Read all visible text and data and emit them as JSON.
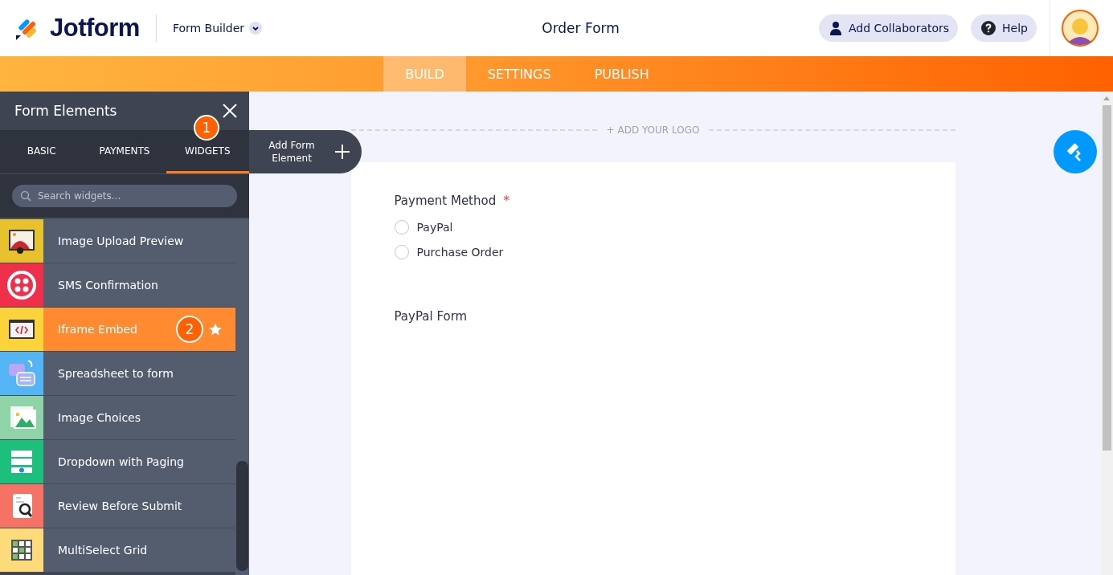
{
  "header": {
    "brand": "Jotform",
    "menu": "Form Builder",
    "title": "Order Form",
    "buttons": [
      "Add Collaborators",
      "Help"
    ]
  },
  "nav_tabs": [
    {
      "label": "BUILD",
      "selected": true
    },
    {
      "label": "SETTINGS",
      "selected": false
    },
    {
      "label": "PUBLISH",
      "selected": false
    }
  ],
  "sidebar": {
    "title": "Form Elements",
    "tabs": [
      {
        "label": "BASIC",
        "selected": false
      },
      {
        "label": "PAYMENTS",
        "selected": false
      },
      {
        "label": "WIDGETS",
        "selected": true
      }
    ],
    "tab_callout": "1",
    "search": {
      "placeholder": "Search widgets..."
    },
    "items": [
      {
        "label": "Image Upload Preview",
        "kind": "image-upload",
        "color": "#e8c22e",
        "selected": false
      },
      {
        "label": "SMS Confirmation",
        "kind": "sms",
        "color": "#f0304b",
        "selected": false
      },
      {
        "label": "Iframe Embed",
        "kind": "iframe",
        "color": "#fdd33b",
        "selected": true,
        "callout": "2"
      },
      {
        "label": "Spreadsheet to form",
        "kind": "spreadsheet",
        "color": "#54b5f5",
        "selected": false
      },
      {
        "label": "Image Choices",
        "kind": "image-choices",
        "color": "#8fd3a8",
        "selected": false
      },
      {
        "label": "Dropdown with Paging",
        "kind": "dropdown",
        "color": "#1cbf7c",
        "selected": false
      },
      {
        "label": "Review Before Submit",
        "kind": "review",
        "color": "#f57264",
        "selected": false
      },
      {
        "label": "MultiSelect Grid",
        "kind": "grid",
        "color": "#fedb7a",
        "selected": false
      }
    ]
  },
  "add_element": "Add Form Element",
  "form": {
    "logo_placeholder": "+ ADD YOUR LOGO",
    "fields": [
      {
        "kind": "radio",
        "label": "Payment Method",
        "required_mark": "*",
        "options": [
          {
            "label": "PayPal",
            "selected": false
          },
          {
            "label": "Purchase Order",
            "selected": false
          }
        ]
      },
      {
        "kind": "heading",
        "label": "PayPal Form"
      }
    ]
  }
}
